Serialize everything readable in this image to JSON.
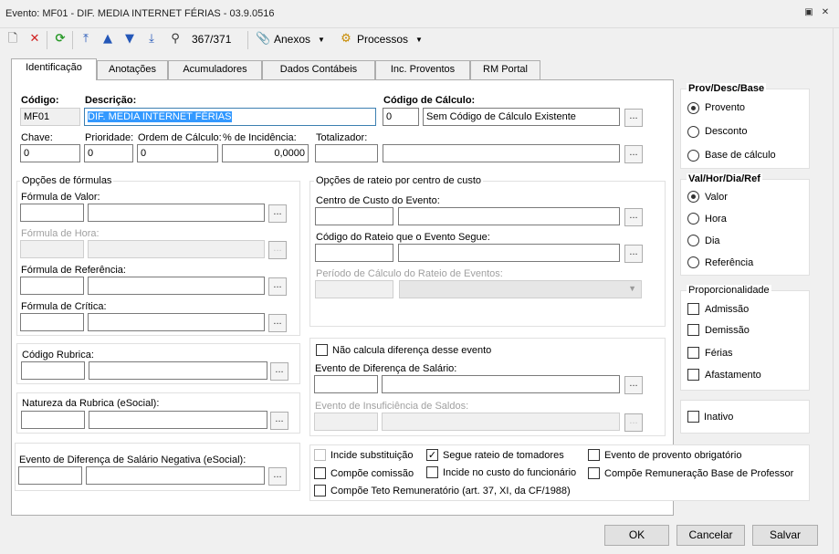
{
  "window": {
    "title": "Evento: MF01 - DIF. MEDIA INTERNET FÉRIAS - 03.9.0516"
  },
  "toolbar": {
    "record_counter": "367/371",
    "anexos_label": "Anexos",
    "processos_label": "Processos"
  },
  "tabs": [
    "Identificação",
    "Anotações",
    "Acumuladores",
    "Dados Contábeis",
    "Inc. Proventos",
    "RM Portal"
  ],
  "ident": {
    "codigo_label": "Código:",
    "codigo_value": "MF01",
    "descricao_label": "Descrição:",
    "descricao_value": "DIF. MEDIA INTERNET FÉRIAS",
    "codcalc_label": "Código de Cálculo:",
    "codcalc_value": "0",
    "codcalc_desc": "Sem Código de Cálculo Existente",
    "chave_label": "Chave:",
    "chave_value": "0",
    "prioridade_label": "Prioridade:",
    "prioridade_value": "0",
    "ordem_label": "Ordem de Cálculo:",
    "ordem_value": "0",
    "incidencia_label": "% de Incidência:",
    "incidencia_value": "0,0000",
    "totalizador_label": "Totalizador:",
    "totalizador_value": ""
  },
  "formulas": {
    "title": "Opções de fórmulas",
    "valor_label": "Fórmula de Valor:",
    "hora_label": "Fórmula de Hora:",
    "referencia_label": "Fórmula de Referência:",
    "critica_label": "Fórmula de Crítica:"
  },
  "rateio": {
    "title": "Opções de rateio por centro de custo",
    "centro_label": "Centro de Custo do Evento:",
    "codigo_label": "Código do Rateio que o Evento Segue:",
    "periodo_label": "Período de Cálculo do Rateio de Eventos:"
  },
  "rubrica": {
    "label": "Código Rubrica:"
  },
  "natureza": {
    "label": "Natureza da Rubrica (eSocial):"
  },
  "negativa": {
    "label": "Evento de Diferença de Salário Negativa (eSocial):"
  },
  "diferenca": {
    "nao_calcula_label": "Não calcula diferença desse evento",
    "evento_dif_label": "Evento de Diferença de Salário:",
    "insuficiencia_label": "Evento de Insuficiência de Saldos:"
  },
  "flags": {
    "incide_substituicao": "Incide substituição",
    "segue_rateio": "Segue rateio de tomadores",
    "provento_obrigatorio": "Evento de provento obrigatório",
    "compoe_comissao": "Compõe comissão",
    "incide_custo": "Incide no custo do funcionário",
    "compoe_remuneracao": "Compõe Remuneração Base de Professor",
    "compoe_teto": "Compõe Teto Remuneratório (art. 37, XI, da CF/1988)"
  },
  "prov_desc_base": {
    "title": "Prov/Desc/Base",
    "options": [
      "Provento",
      "Desconto",
      "Base de cálculo"
    ],
    "selected": "Provento"
  },
  "val_hor": {
    "title": "Val/Hor/Dia/Ref",
    "options": [
      "Valor",
      "Hora",
      "Dia",
      "Referência"
    ],
    "selected": "Valor"
  },
  "proporcionalidade": {
    "title": "Proporcionalidade",
    "options": [
      "Admissão",
      "Demissão",
      "Férias",
      "Afastamento"
    ]
  },
  "inativo_label": "Inativo",
  "buttons": {
    "ok": "OK",
    "cancelar": "Cancelar",
    "salvar": "Salvar"
  },
  "colors": {
    "selection": "#3399ff",
    "panel_bg": "#ffffff",
    "window_bg": "#f0f0f0"
  }
}
